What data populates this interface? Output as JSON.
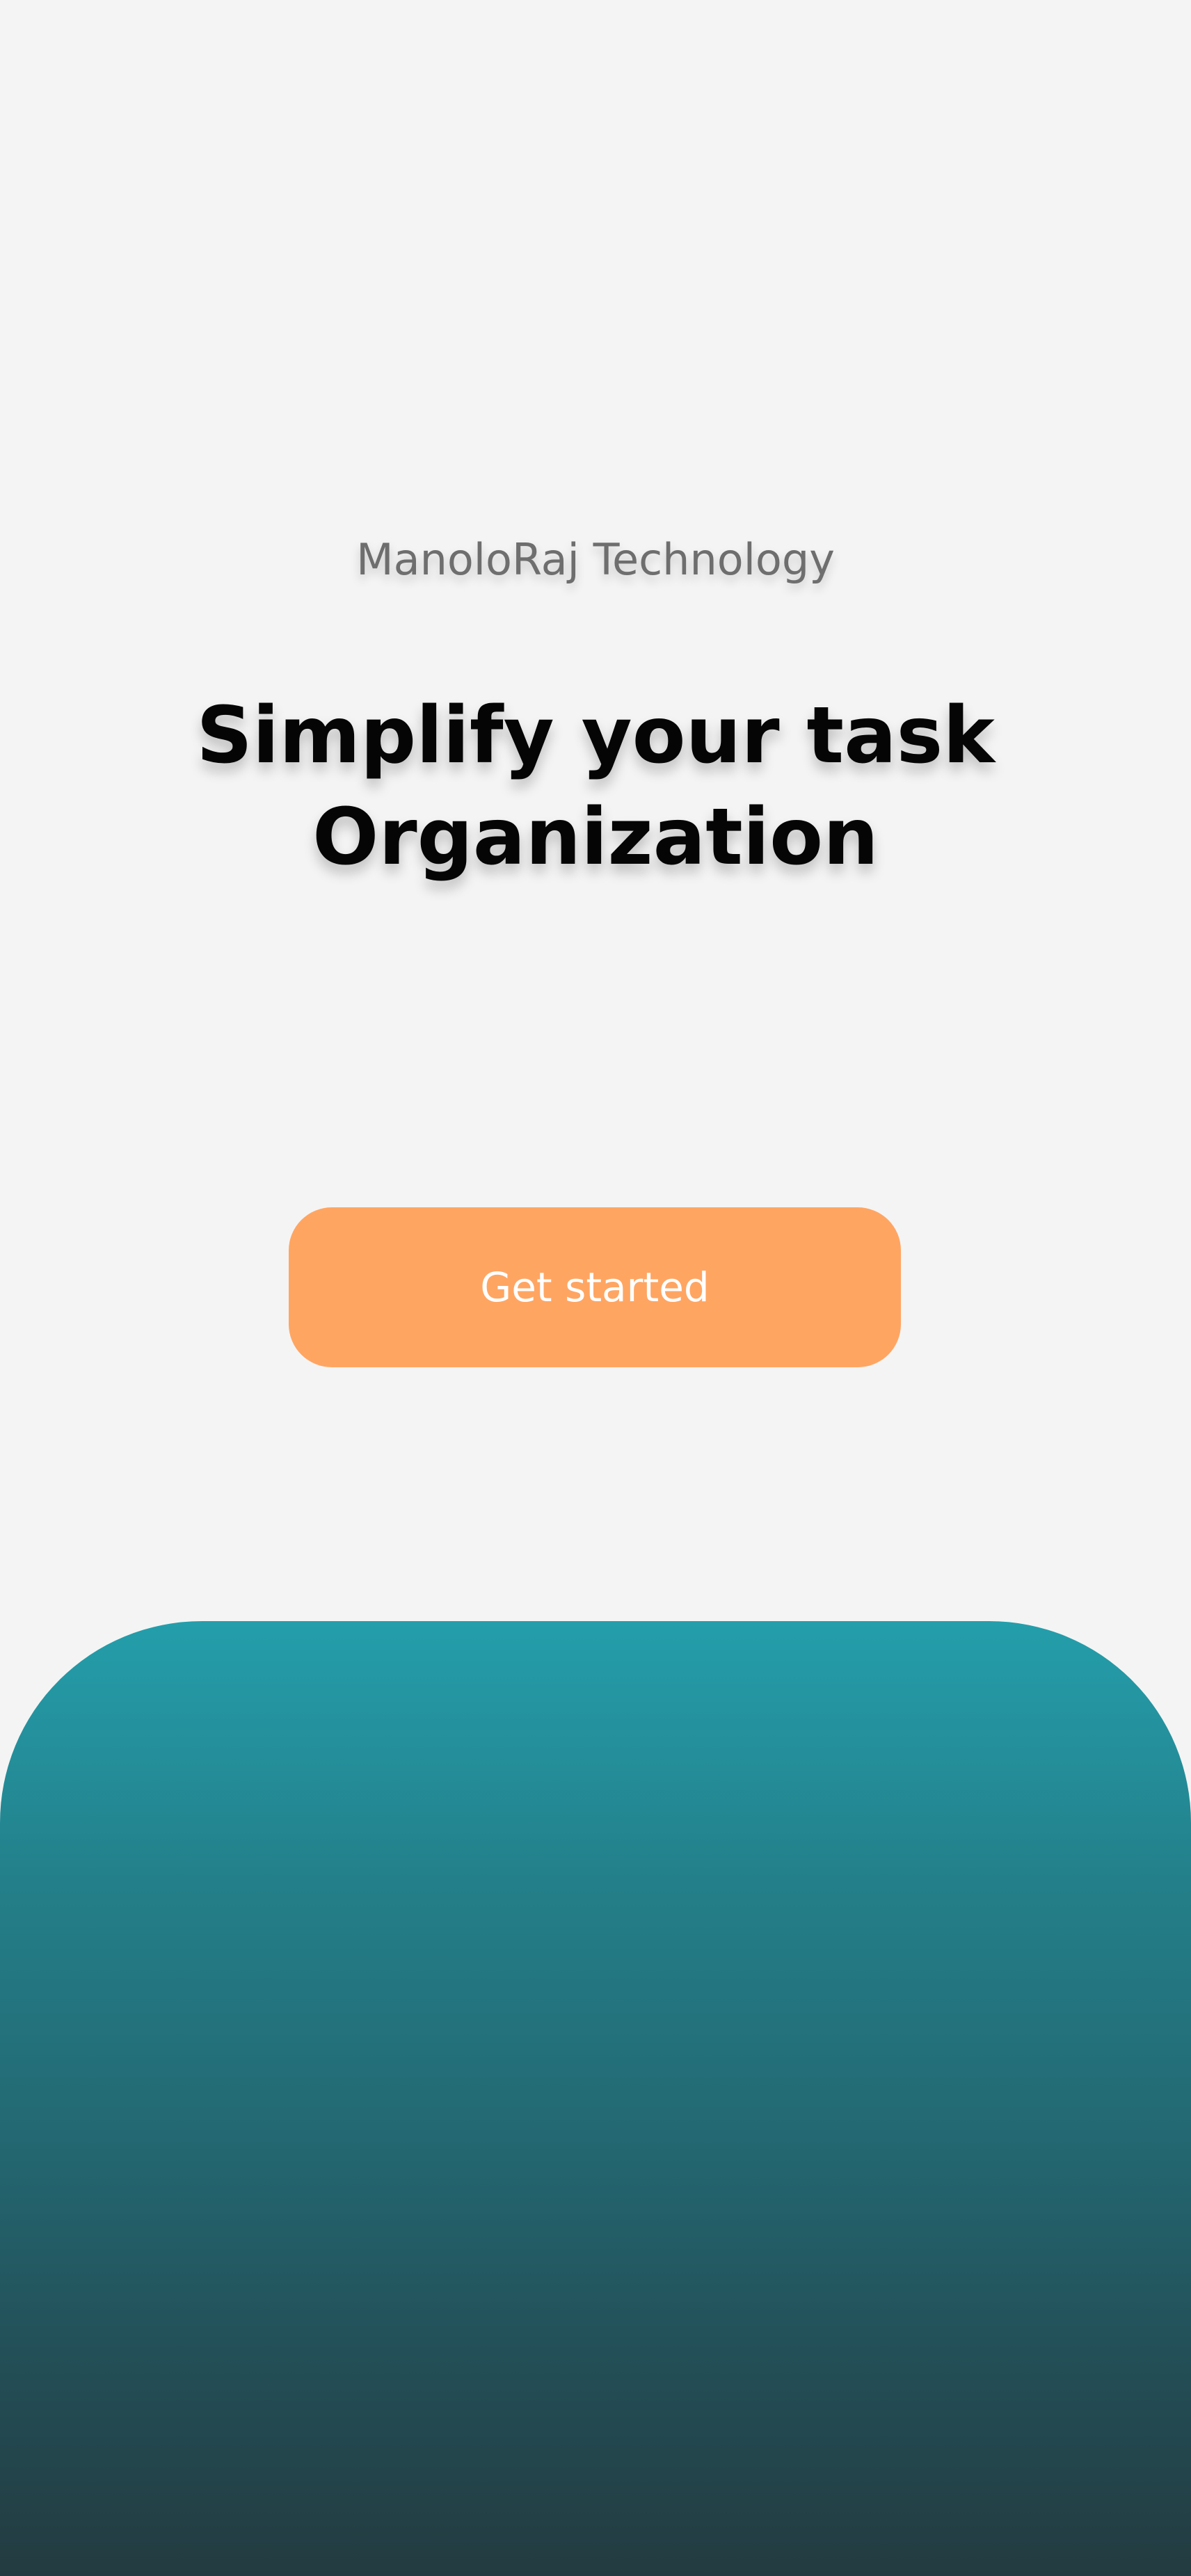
{
  "app": {
    "company_name": "ManoloRaj Technology",
    "headline": {
      "line1": "Simplify your task",
      "line2": "Organization"
    },
    "cta_label": "Get started"
  },
  "colors": {
    "background": "#f4f4f4",
    "accent_button": "#ffa562",
    "panel_gradient_top": "#249eab",
    "panel_gradient_bottom": "#233b40",
    "headline_text": "#050505",
    "company_text": "#6e6e6e"
  }
}
